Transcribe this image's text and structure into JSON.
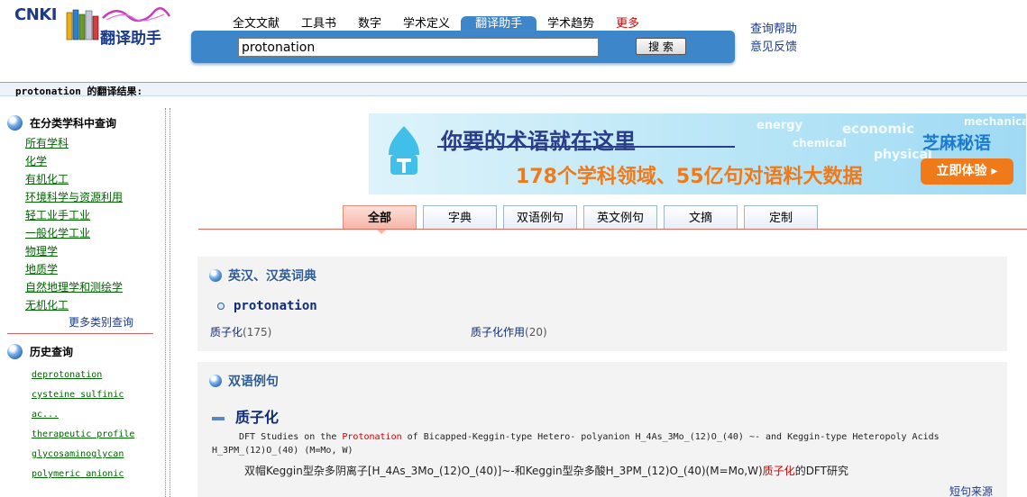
{
  "header": {
    "logo_text": "CNKI",
    "logo_name": "翻译助手",
    "tabs": [
      {
        "label": "全文文献"
      },
      {
        "label": "工具书"
      },
      {
        "label": "数字"
      },
      {
        "label": "学术定义"
      },
      {
        "label": "翻译助手",
        "active": true
      },
      {
        "label": "学术趋势"
      },
      {
        "label": "更多"
      }
    ],
    "search_value": "protonation",
    "search_button": "搜 索",
    "help_links": [
      "查询帮助",
      "意见反馈"
    ]
  },
  "result_bar": "protonation 的翻译结果:",
  "sidebar": {
    "category_title": "在分类学科中查询",
    "categories": [
      "所有学科",
      "化学",
      "有机化工",
      "环境科学与资源利用",
      "轻工业手工业",
      "一般化学工业",
      "物理学",
      "地质学",
      "自然地理学和测绘学",
      "无机化工"
    ],
    "more_categories": "更多类别查询",
    "history_title": "历史查询",
    "history": [
      "deprotonation",
      "cysteine sulfinic ac...",
      "therapeutic profile",
      "glycosaminoglycan",
      "polymeric anionic"
    ]
  },
  "banner": {
    "slogan1": "你要的术语就在这里",
    "slogan2": "178个学科领域、55亿句对语料大数据",
    "brand": "芝麻秘语",
    "cta": "立即体验 ▸",
    "bg_words": [
      "energy",
      "economic",
      "mechanical",
      "chemical",
      "physical"
    ]
  },
  "result_tabs": [
    {
      "label": "全部",
      "active": true
    },
    {
      "label": "字典"
    },
    {
      "label": "双语例句"
    },
    {
      "label": "英文例句"
    },
    {
      "label": "文摘"
    },
    {
      "label": "定制"
    }
  ],
  "dictionary": {
    "title": "英汉、汉英词典",
    "term": "protonation",
    "translations": [
      {
        "text": "质子化",
        "count": "(175)"
      },
      {
        "text": "质子化作用",
        "count": "(20)"
      }
    ]
  },
  "bilingual": {
    "title": "双语例句",
    "subhead": "质子化",
    "example_en_pre": "DFT Studies on the ",
    "example_en_hl": "Protonation",
    "example_en_post": " of Bicapped-Keggin-type Hetero- polyanion H_4As_3Mo_(12)O_(40) ~- and Keggin-type Heteropoly Acids H_3PM_(12)O_(40) (M=Mo, W)",
    "example_zh_pre": "双帽Keggin型杂多阴离子[H_4As_3Mo_(12)O_(40)]~-和Keggin型杂多酸H_3PM_(12)O_(40)(M=Mo,W)",
    "example_zh_hl": "质子化",
    "example_zh_post": "的DFT研究",
    "source": "短句来源"
  },
  "colors": {
    "brand_blue": "#3d86c9",
    "link_green": "#006600",
    "highlight_red": "#cc0000",
    "accent_orange": "#f07a1a"
  }
}
